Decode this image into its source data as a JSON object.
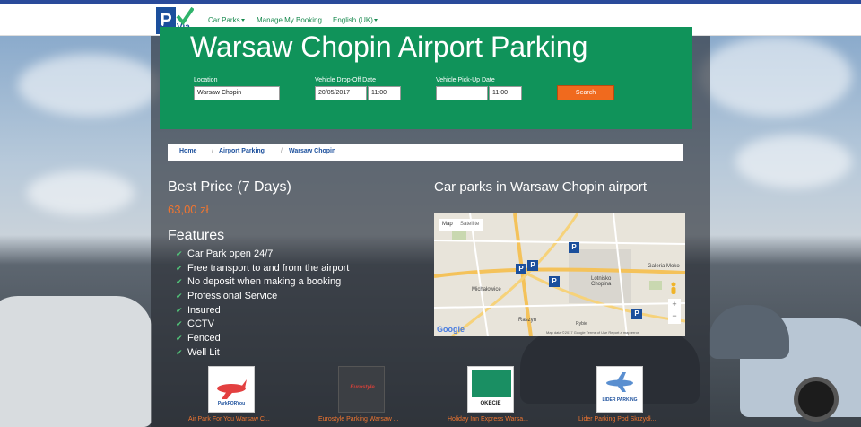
{
  "nav": {
    "logo_text": "Park Via",
    "links": [
      {
        "label": "Car Parks",
        "dropdown": true
      },
      {
        "label": "Manage My Booking",
        "dropdown": false
      },
      {
        "label": "English (UK)",
        "dropdown": true
      }
    ]
  },
  "hero": {
    "title": "Warsaw Chopin Airport Parking",
    "location_label": "Location",
    "location_value": "Warsaw Chopin",
    "dropoff_label": "Vehicle Drop-Off Date",
    "dropoff_date": "20/05/2017",
    "dropoff_time": "11:00",
    "pickup_label": "Vehicle Pick-Up Date",
    "pickup_date": "",
    "pickup_time": "11:00",
    "search_label": "Search"
  },
  "breadcrumb": [
    "Home",
    "Airport Parking",
    "Warsaw Chopin"
  ],
  "pricing": {
    "heading": "Best Price (7 Days)",
    "price": "63,00 zł"
  },
  "features": {
    "heading": "Features",
    "items": [
      "Car Park open 24/7",
      "Free transport to and from the airport",
      "No deposit when making a booking",
      "Professional Service",
      "Insured",
      "CCTV",
      "Fenced",
      "Well Lit"
    ]
  },
  "map": {
    "heading": "Car parks in Warsaw Chopin airport",
    "tab_map": "Map",
    "tab_satellite": "Satellite",
    "place_labels": [
      "Michałowice",
      "Raszyn",
      "Lotnisko Chopina",
      "Galeria Moko",
      "Rybie"
    ],
    "footer": "Map data ©2017 Google   Terms of Use   Report a map error",
    "google": "Google"
  },
  "partners": [
    {
      "name": "Air Park For You Warsaw C...",
      "logo": "ParkFORYou"
    },
    {
      "name": "Eurostyle Parking Warsaw ...",
      "logo": "Eurostyle"
    },
    {
      "name": "Holiday Inn Express Warsa...",
      "logo": "OKECIE"
    },
    {
      "name": "Lider Parking Pod Skrzydł...",
      "logo": "LIDER PARKING"
    }
  ],
  "colors": {
    "hero_green": "#10935a",
    "accent_orange": "#f06a1e",
    "link_green": "#16894d",
    "link_blue": "#1b4f9c"
  }
}
